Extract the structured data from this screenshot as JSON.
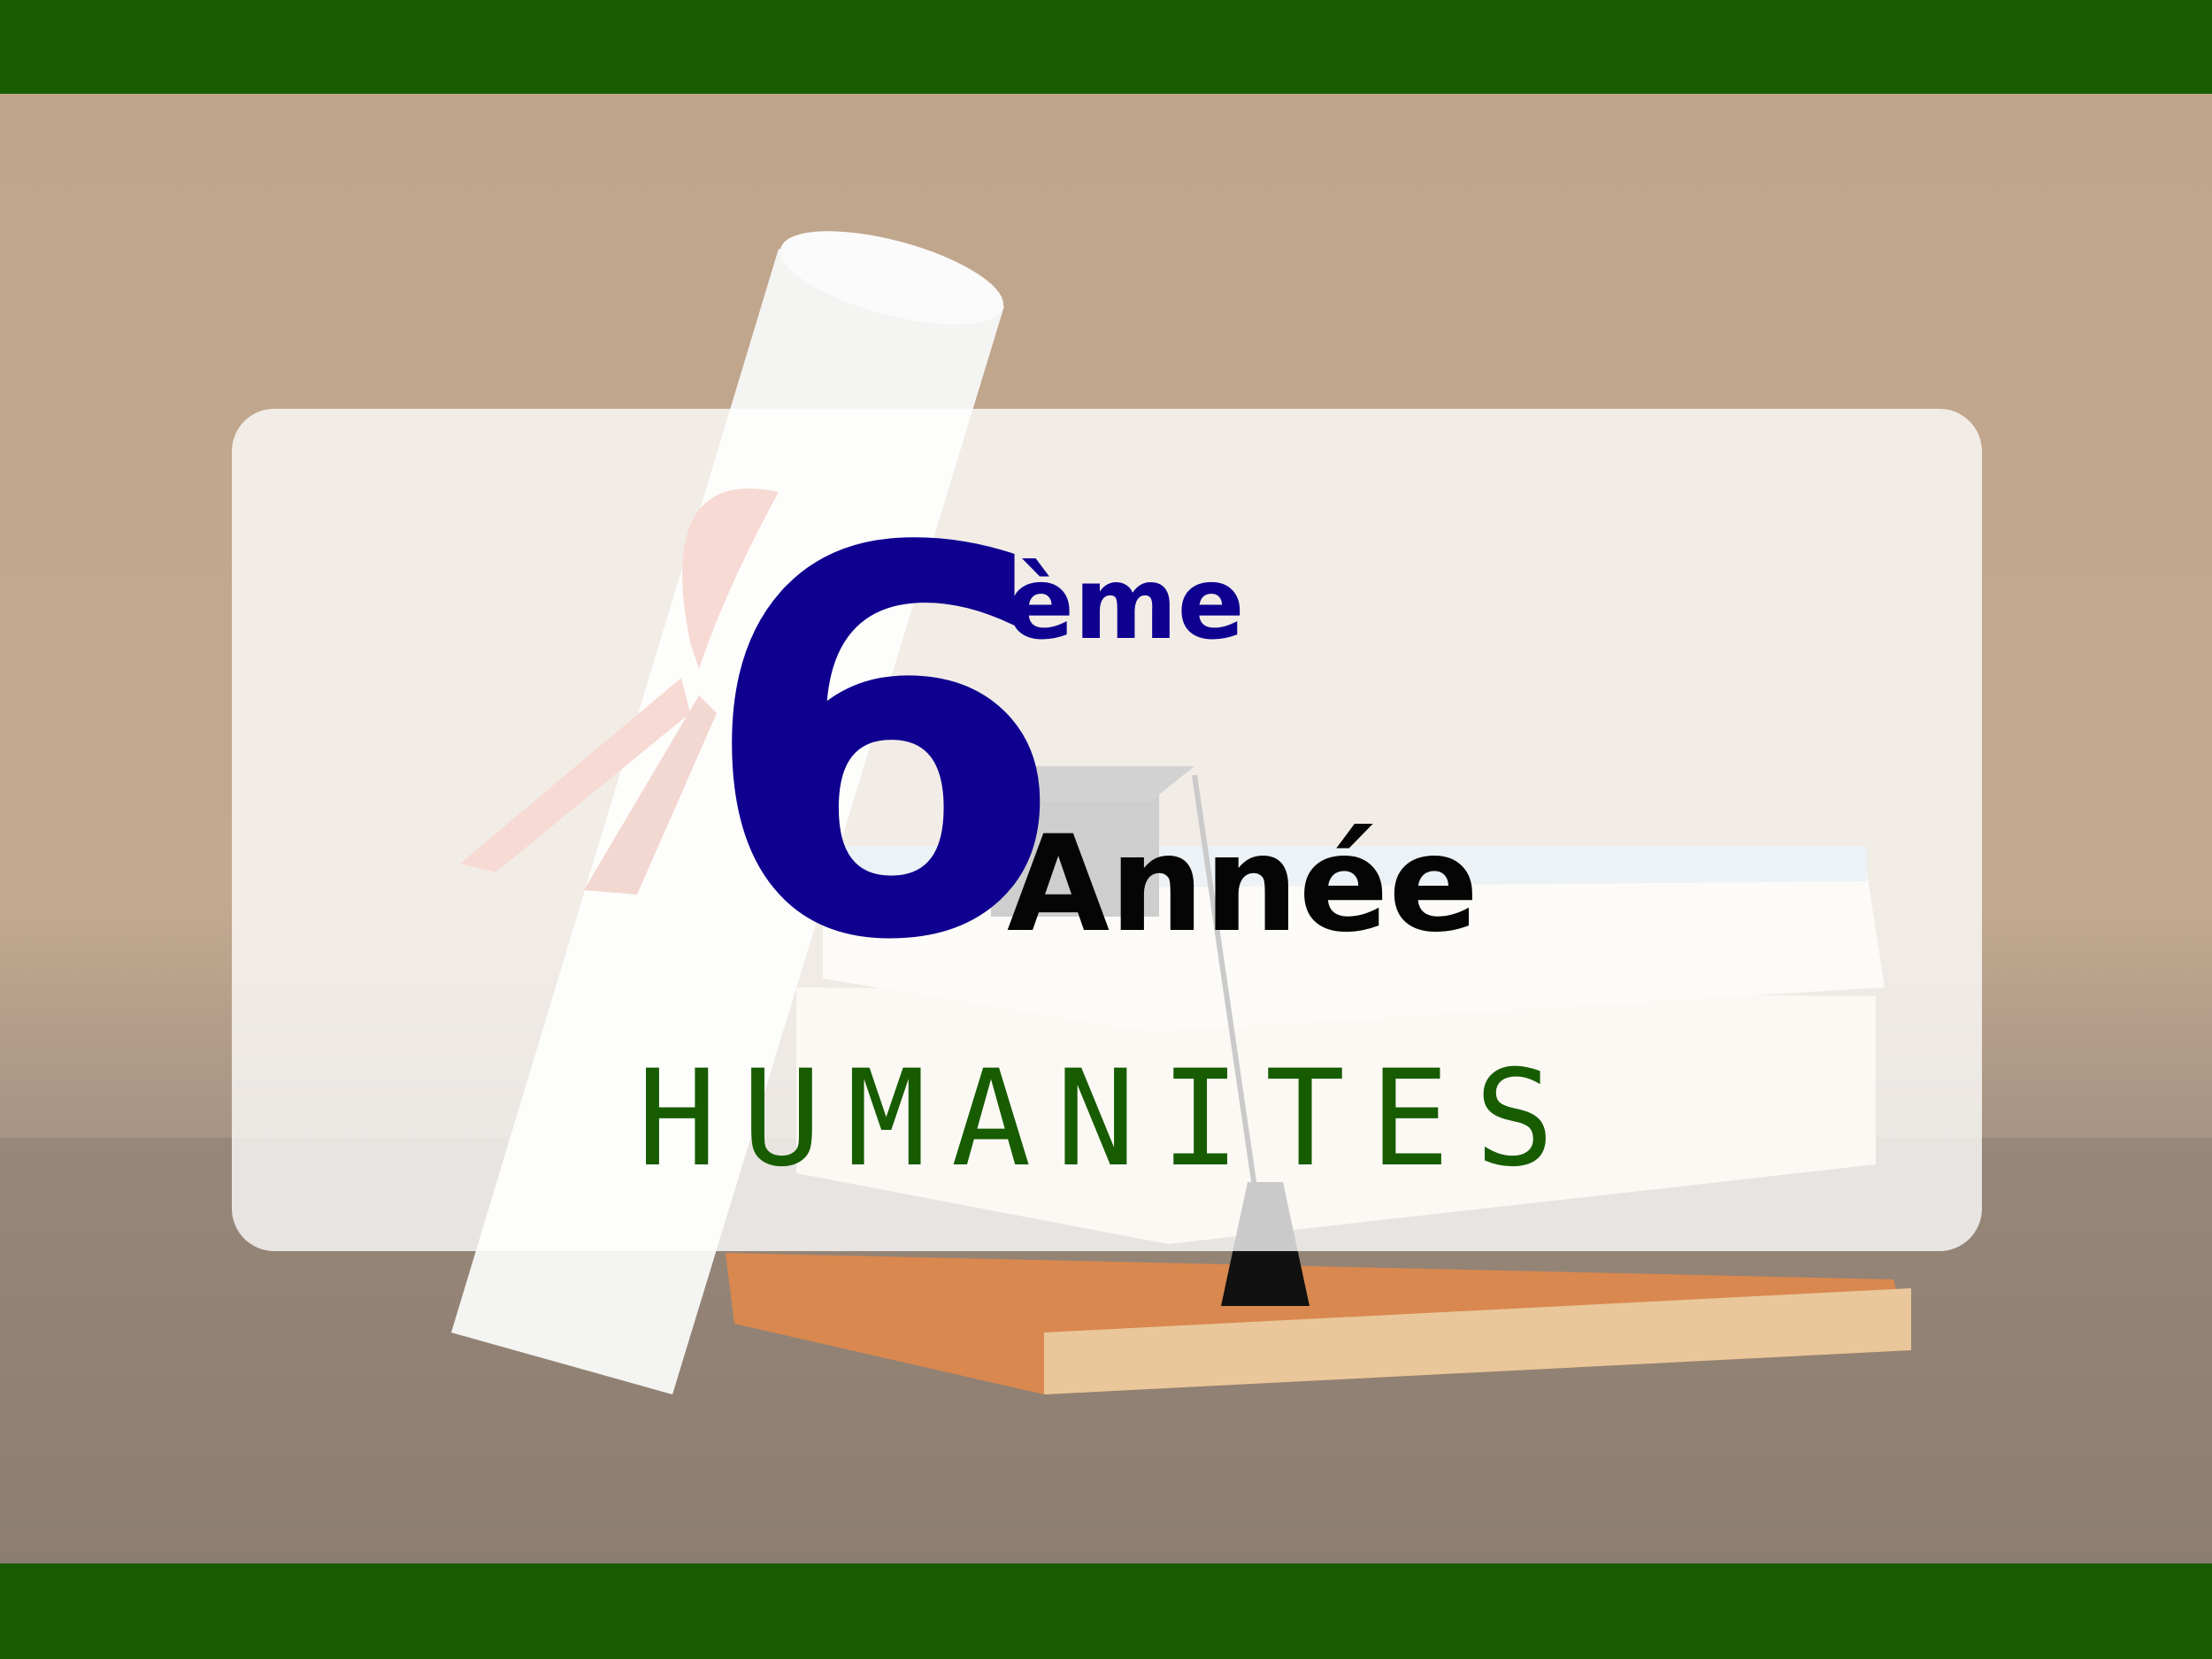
{
  "image": {
    "description_free": true,
    "colors": {
      "bar": "#175c00",
      "number": "#0f0090",
      "annee": "#050505",
      "humanites": "#175c00",
      "card": "rgba(255,255,255,0.78)"
    }
  },
  "title": {
    "number": "6",
    "superscript": "ème",
    "word": "Année",
    "subject": "HUMANITES"
  }
}
